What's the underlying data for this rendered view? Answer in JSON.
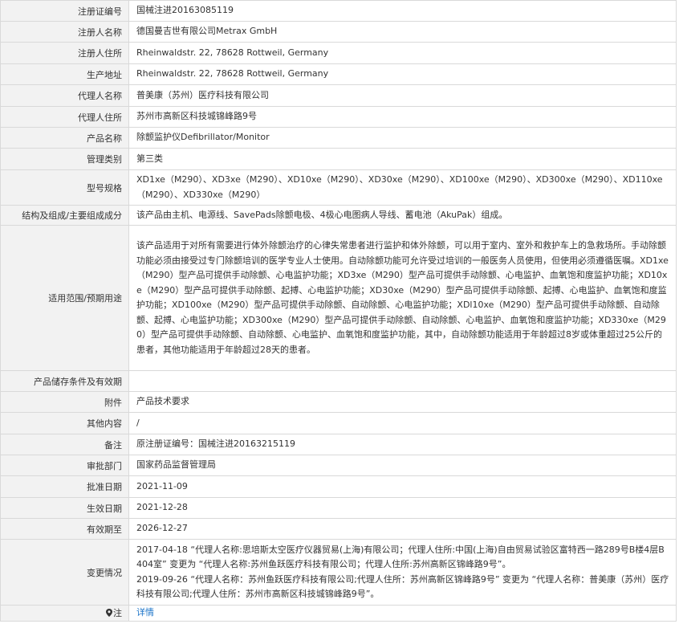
{
  "rows": [
    {
      "label": "注册证编号",
      "value": "国械注进20163085119"
    },
    {
      "label": "注册人名称",
      "value": "德国曼吉世有限公司Metrax GmbH"
    },
    {
      "label": "注册人住所",
      "value": "Rheinwaldstr. 22, 78628 Rottweil, Germany"
    },
    {
      "label": "生产地址",
      "value": "Rheinwaldstr. 22, 78628 Rottweil, Germany"
    },
    {
      "label": "代理人名称",
      "value": "普美康（苏州）医疗科技有限公司"
    },
    {
      "label": "代理人住所",
      "value": "苏州市高新区科技城锦峰路9号"
    },
    {
      "label": "产品名称",
      "value": "除颤监护仪Defibrillator/Monitor"
    },
    {
      "label": "管理类别",
      "value": "第三类"
    },
    {
      "label": "型号规格",
      "value": "XD1xe（M290）、XD3xe（M290）、XD10xe（M290）、XD30xe（M290）、XD100xe（M290）、XD300xe（M290）、XD110xe（M290）、XD330xe（M290）"
    },
    {
      "label": "结构及组成/主要组成成分",
      "value": "该产品由主机、电源线、SavePads除颤电极、4极心电图病人导线、蓄电池（AkuPak）组成。"
    },
    {
      "label": "适用范围/预期用途",
      "value": "该产品适用于对所有需要进行体外除颤治疗的心律失常患者进行监护和体外除颤，可以用于室内、室外和救护车上的急救场所。手动除颤功能必须由接受过专门除颤培训的医学专业人士使用。自动除颤功能可允许受过培训的一般医务人员使用，但使用必须遵循医嘱。XD1xe（M290）型产品可提供手动除颤、心电监护功能；XD3xe（M290）型产品可提供手动除颤、心电监护、血氧饱和度监护功能；XD10xe（M290）型产品可提供手动除颤、起搏、心电监护功能；XD30xe（M290）型产品可提供手动除颤、起搏、心电监护、血氧饱和度监护功能；XD100xe（M290）型产品可提供手动除颤、自动除颤、心电监护功能；XDl10xe（M290）型产品可提供手动除颤、自动除颤、起搏、心电监护功能；XD300xe（M290）型产品可提供手动除颤、自动除颤、心电监护、血氧饱和度监护功能；XD330xe（M290）型产品可提供手动除颤、自动除颤、心电监护、血氧饱和度监护功能，其中，自动除颤功能适用于年龄超过8岁或体重超过25公斤的患者，其他功能适用于年龄超过28天的患者。"
    },
    {
      "label": "产品储存条件及有效期",
      "value": ""
    },
    {
      "label": "附件",
      "value": "产品技术要求"
    },
    {
      "label": "其他内容",
      "value": "/"
    },
    {
      "label": "备注",
      "value": "原注册证编号：国械注进20163215119"
    },
    {
      "label": "审批部门",
      "value": "国家药品监督管理局"
    },
    {
      "label": "批准日期",
      "value": "2021-11-09"
    },
    {
      "label": "生效日期",
      "value": "2021-12-28"
    },
    {
      "label": "有效期至",
      "value": "2026-12-27"
    }
  ],
  "changes": {
    "label": "变更情况",
    "entries": [
      "2017-04-18 “代理人名称:思培斯太空医疗仪器贸易(上海)有限公司；代理人住所:中国(上海)自由贸易试验区富特西一路289号B楼4层B404室” 变更为 “代理人名称:苏州鱼跃医疗科技有限公司；代理人住所:苏州高新区锦峰路9号”。",
      "2019-09-26 “代理人名称：苏州鱼跃医疗科技有限公司;代理人住所：苏州高新区锦峰路9号” 变更为 “代理人名称：普美康（苏州）医疗科技有限公司;代理人住所：苏州市高新区科技城锦峰路9号”。"
    ]
  },
  "note": {
    "label": "注",
    "icon": "map-pin-icon",
    "link_text": "详情"
  },
  "colors": {
    "label_bg": "#f2f2f2",
    "border": "#d9d9d9",
    "link": "#1a73c8",
    "text": "#333333"
  }
}
